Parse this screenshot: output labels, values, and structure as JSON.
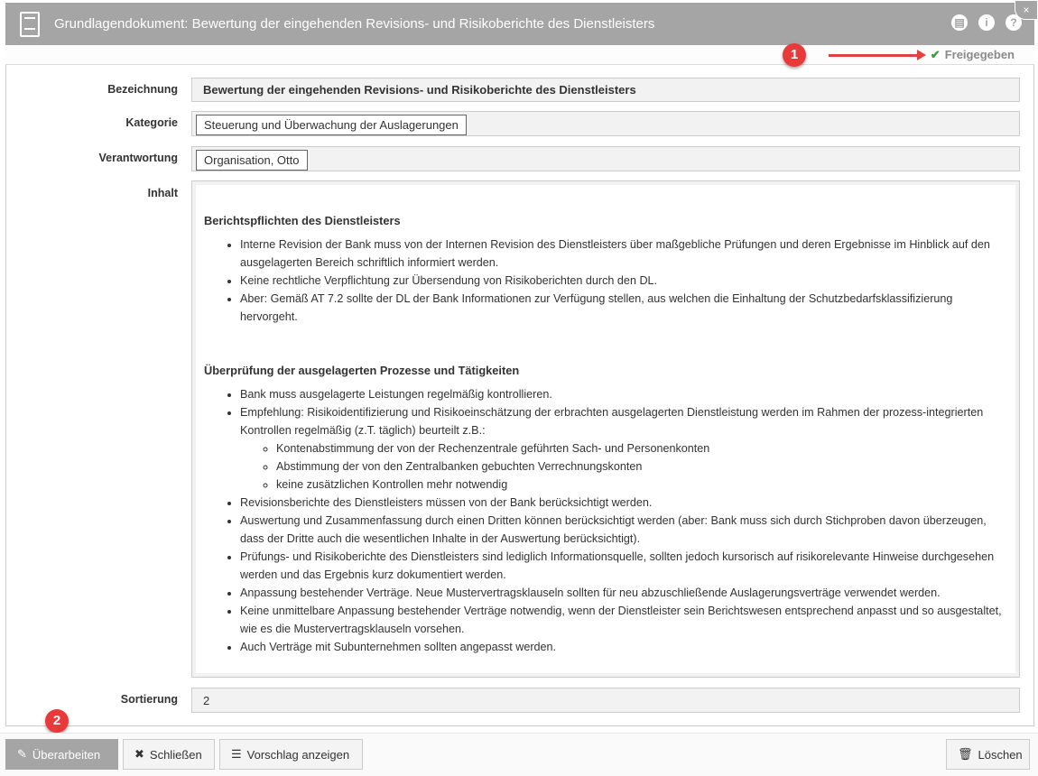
{
  "window": {
    "title": "Grundlagendokument: Bewertung der eingehenden Revisions- und Risikoberichte des Dienstleisters",
    "icons": [
      "pdf-icon",
      "info-icon",
      "help-icon"
    ],
    "close": "×"
  },
  "status": {
    "label": "Freigegeben",
    "color": "#3a9d3a"
  },
  "annotations": {
    "one": "1",
    "two": "2"
  },
  "form": {
    "bezeichnung": {
      "label": "Bezeichnung",
      "value": "Bewertung der eingehenden Revisions- und Risikoberichte des Dienstleisters"
    },
    "kategorie": {
      "label": "Kategorie",
      "value": "Steuerung und Überwachung der Auslagerungen"
    },
    "verantwortung": {
      "label": "Verantwortung",
      "value": "Organisation, Otto"
    },
    "inhalt": {
      "label": "Inhalt",
      "s1": {
        "heading": "Berichtspflichten des Dienstleisters",
        "items": [
          "Interne Revision der Bank muss von der Internen Revision des Dienstleisters über maßgebliche Prüfungen und deren Ergebnisse im Hinblick auf den ausgelagerten Bereich schriftlich informiert werden.",
          "Keine rechtliche Verpflichtung zur Übersendung von Risikoberichten durch den DL.",
          "Aber: Gemäß AT 7.2 sollte der DL der Bank Informationen zur Verfügung stellen, aus welchen die Einhaltung der Schutzbedarfsklassifizierung hervorgeht."
        ]
      },
      "s2": {
        "heading": "Überprüfung der ausgelagerten Prozesse und Tätigkeiten",
        "items": [
          "Bank muss ausgelagerte Leistungen regelmäßig kontrollieren.",
          "Empfehlung: Risikoidentifizierung und Risikoeinschätzung der erbrachten ausgelagerten Dienstleistung werden im Rahmen der prozess-integrierten Kontrollen regelmäßig (z.T. täglich) beurteilt z.B.:",
          "Revisionsberichte des Dienstleisters müssen von der Bank berücksichtigt werden.",
          "Auswertung und Zusammenfassung durch einen Dritten können berücksichtigt werden (aber: Bank muss sich durch Stichproben davon überzeugen, dass der Dritte auch die wesentlichen Inhalte in der Auswertung berücksichtigt).",
          "Prüfungs- und Risikoberichte des Dienstleisters sind lediglich Informationsquelle, sollten jedoch kursorisch auf risikorelevante Hinweise durchgesehen werden und das Ergebnis kurz dokumentiert werden.",
          "Anpassung bestehender Verträge. Neue Mustervertragsklauseln sollten für neu abzuschließende Auslagerungsverträge verwendet werden.",
          "Keine unmittelbare Anpassung bestehender Verträge notwendig, wenn der Dienstleister sein Berichtswesen entsprechend anpasst und so ausgestaltet, wie es die Mustervertragsklauseln vorsehen.",
          "Auch Verträge mit Subunternehmen sollten angepasst werden."
        ],
        "subitems": [
          "Kontenabstimmung der von der Rechenzentrale geführten Sach- und Personenkonten",
          "Abstimmung der von den Zentralbanken gebuchten Verrechnungskonten",
          "keine zusätzlichen Kontrollen mehr notwendig"
        ]
      }
    },
    "sortierung": {
      "label": "Sortierung",
      "value": "2"
    }
  },
  "footer": {
    "edit": "Überarbeiten",
    "close": "Schließen",
    "proposal": "Vorschlag anzeigen",
    "delete": "Löschen"
  }
}
